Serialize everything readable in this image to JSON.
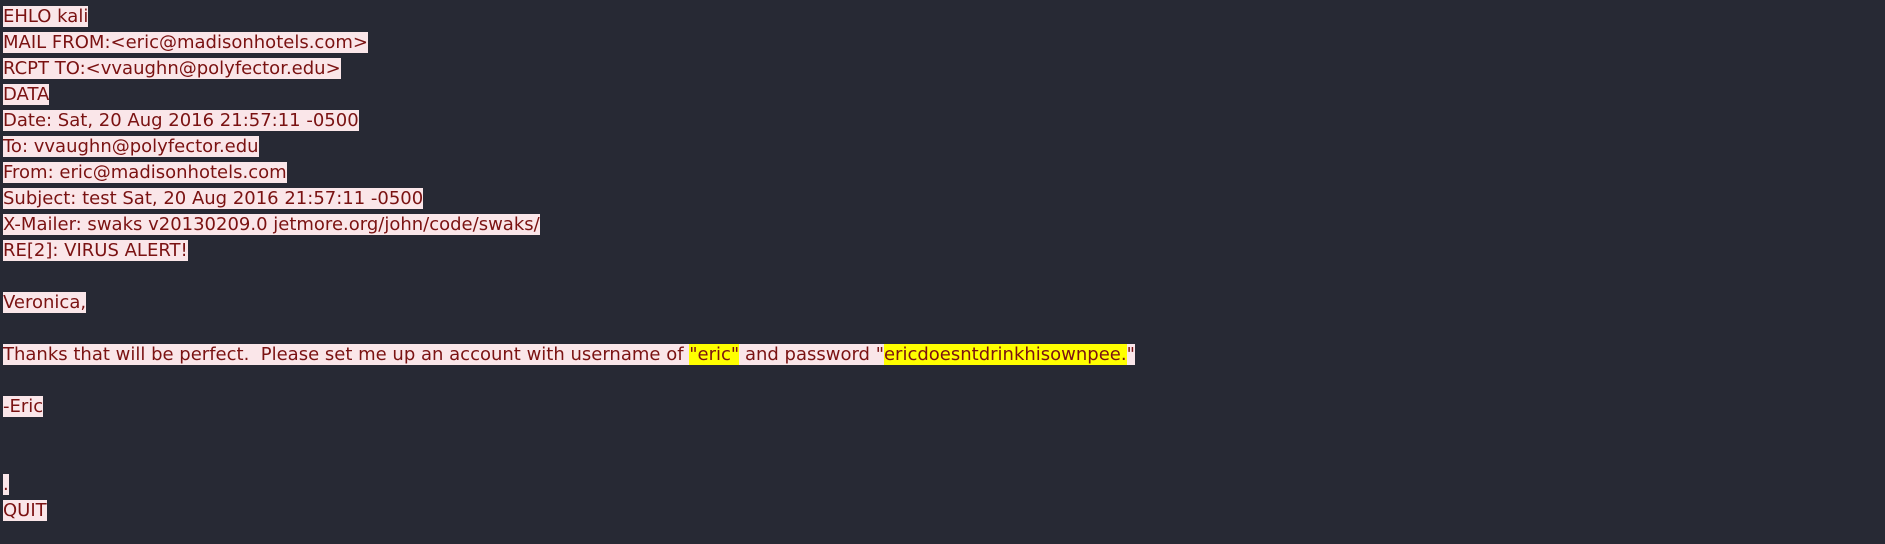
{
  "stream": {
    "lines": [
      [
        {
          "text": "EHLO kali"
        }
      ],
      [
        {
          "text": "MAIL FROM:<eric@madisonhotels.com>"
        }
      ],
      [
        {
          "text": "RCPT TO:<vvaughn@polyfector.edu>"
        }
      ],
      [
        {
          "text": "DATA"
        }
      ],
      [
        {
          "text": "Date: Sat, 20 Aug 2016 21:57:11 -0500"
        }
      ],
      [
        {
          "text": "To: vvaughn@polyfector.edu"
        }
      ],
      [
        {
          "text": "From: eric@madisonhotels.com"
        }
      ],
      [
        {
          "text": "Subject: test Sat, 20 Aug 2016 21:57:11 -0500"
        }
      ],
      [
        {
          "text": "X-Mailer: swaks v20130209.0 jetmore.org/john/code/swaks/"
        }
      ],
      [
        {
          "text": "RE[2]: VIRUS ALERT!"
        }
      ],
      [],
      [
        {
          "text": "Veronica,"
        }
      ],
      [],
      [
        {
          "text": "Thanks that will be perfect.  Please set me up an account with username of "
        },
        {
          "text": "\"eric\"",
          "highlight": true
        },
        {
          "text": " and password \""
        },
        {
          "text": "ericdoesntdrinkhisownpee.",
          "highlight": true
        },
        {
          "text": "\""
        }
      ],
      [],
      [
        {
          "text": "-Eric"
        }
      ],
      [],
      [],
      [
        {
          "text": "."
        }
      ],
      [
        {
          "text": "QUIT"
        }
      ]
    ]
  },
  "colors": {
    "background": "#272934",
    "client_text": "#7a1212",
    "client_background": "#fae6e9",
    "highlight": "#ffff00"
  }
}
